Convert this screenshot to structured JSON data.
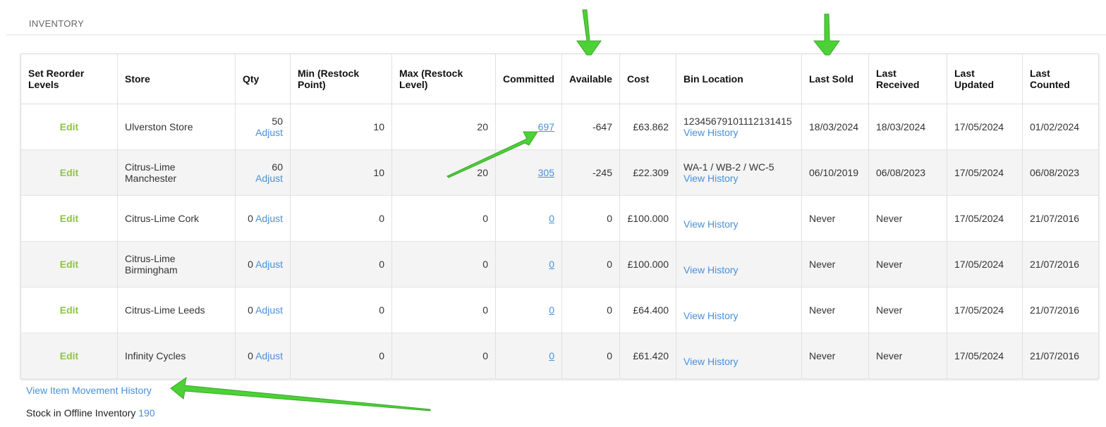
{
  "section": {
    "title": "INVENTORY"
  },
  "table": {
    "headers": {
      "reorder": "Set Reorder Levels",
      "store": "Store",
      "qty": "Qty",
      "min": "Min (Restock Point)",
      "max": "Max (Restock Level)",
      "committed": "Committed",
      "available": "Available",
      "cost": "Cost",
      "bin": "Bin Location",
      "last_sold": "Last Sold",
      "last_received": "Last Received",
      "last_updated": "Last Updated",
      "last_counted": "Last Counted"
    },
    "edit_label": "Edit",
    "adjust_label": "Adjust",
    "view_history_label": "View History",
    "rows": [
      {
        "store": "Ulverston Store",
        "qty": "50",
        "min": "10",
        "max": "20",
        "committed": "697",
        "available": "-647",
        "cost": "£63.862",
        "bin": "12345679101112131415",
        "last_sold": "18/03/2024",
        "last_received": "18/03/2024",
        "last_updated": "17/05/2024",
        "last_counted": "01/02/2024"
      },
      {
        "store": "Citrus-Lime Manchester",
        "qty": "60",
        "min": "10",
        "max": "20",
        "committed": "305",
        "available": "-245",
        "cost": "£22.309",
        "bin": "WA-1 / WB-2 / WC-5",
        "last_sold": "06/10/2019",
        "last_received": "06/08/2023",
        "last_updated": "17/05/2024",
        "last_counted": "06/08/2023"
      },
      {
        "store": "Citrus-Lime Cork",
        "qty": "0",
        "min": "0",
        "max": "0",
        "committed": "0",
        "available": "0",
        "cost": "£100.000",
        "bin": "",
        "last_sold": "Never",
        "last_received": "Never",
        "last_updated": "17/05/2024",
        "last_counted": "21/07/2016"
      },
      {
        "store": "Citrus-Lime Birmingham",
        "qty": "0",
        "min": "0",
        "max": "0",
        "committed": "0",
        "available": "0",
        "cost": "£100.000",
        "bin": "",
        "last_sold": "Never",
        "last_received": "Never",
        "last_updated": "17/05/2024",
        "last_counted": "21/07/2016"
      },
      {
        "store": "Citrus-Lime Leeds",
        "qty": "0",
        "min": "0",
        "max": "0",
        "committed": "0",
        "available": "0",
        "cost": "£64.400",
        "bin": "",
        "last_sold": "Never",
        "last_received": "Never",
        "last_updated": "17/05/2024",
        "last_counted": "21/07/2016"
      },
      {
        "store": "Infinity Cycles",
        "qty": "0",
        "min": "0",
        "max": "0",
        "committed": "0",
        "available": "0",
        "cost": "£61.420",
        "bin": "",
        "last_sold": "Never",
        "last_received": "Never",
        "last_updated": "17/05/2024",
        "last_counted": "21/07/2016"
      }
    ]
  },
  "footer": {
    "movement_history_label": "View Item Movement History",
    "offline_label": "Stock in Offline Inventory",
    "offline_value": "190"
  },
  "colors": {
    "edit_green": "#8cc63f",
    "link_blue": "#4a8fd8",
    "annotation_arrow": "#4cd137"
  }
}
